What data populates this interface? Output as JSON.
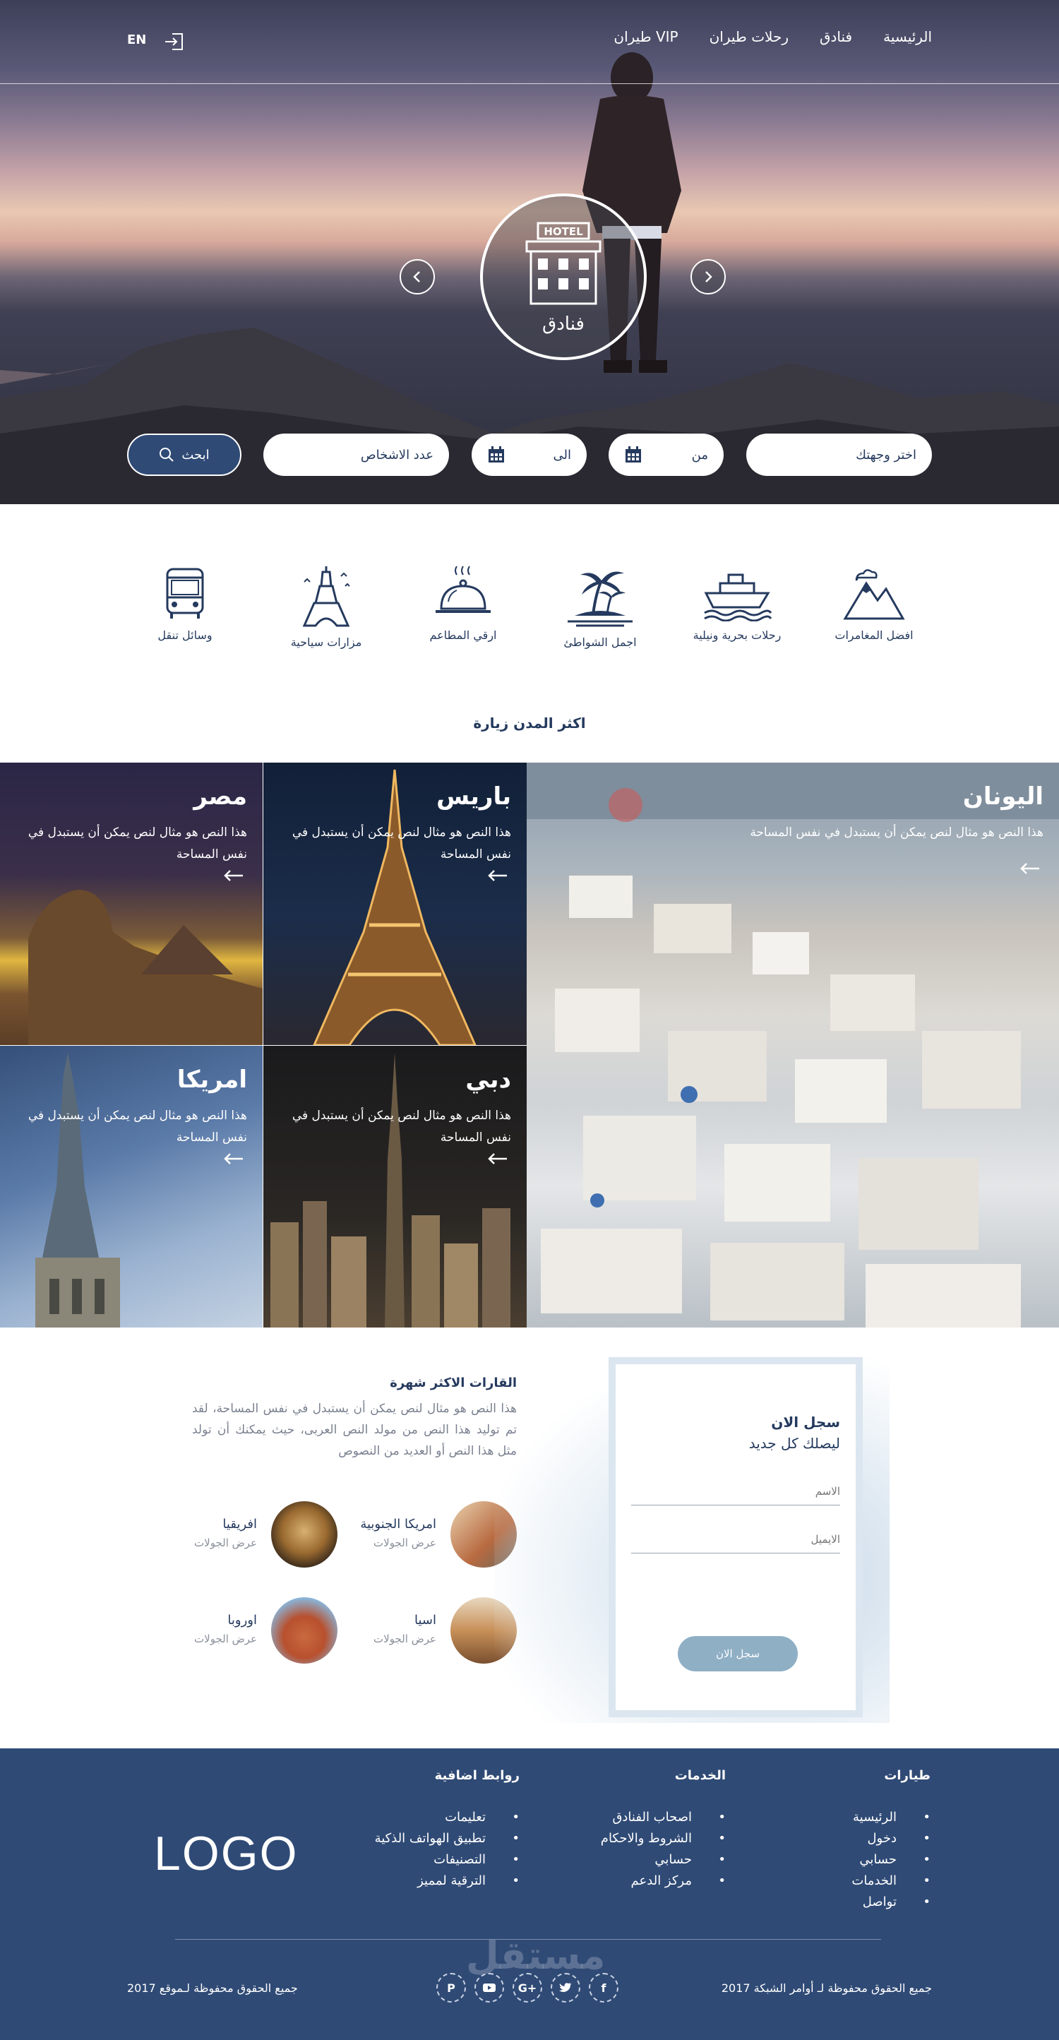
{
  "nav": {
    "items": [
      "الرئيسية",
      "فنادق",
      "رحلات طيران",
      "طيران VIP"
    ],
    "lang": "EN"
  },
  "hero": {
    "circle_sign": "HOTEL",
    "circle_label": "فنادق"
  },
  "search": {
    "destination": "اختر وجهتك",
    "from": "من",
    "to": "الى",
    "persons": "عدد الاشخاص",
    "button": "ابحث"
  },
  "categories": [
    {
      "label": "افضل المغامرات",
      "icon": "mountain-icon"
    },
    {
      "label": "رحلات بحرية ونيلية",
      "icon": "ship-icon"
    },
    {
      "label": "اجمل الشواطئ",
      "icon": "palm-island-icon"
    },
    {
      "label": "ارقي المطاعم",
      "icon": "cloche-icon"
    },
    {
      "label": "مزارات سياحية",
      "icon": "eiffel-icon"
    },
    {
      "label": "وسائل تنقل",
      "icon": "bus-icon"
    }
  ],
  "cities_title": "اكثر المدن زيارة",
  "cities": {
    "greece": {
      "name": "اليونان",
      "desc": "هذا النص هو مثال لنص يمكن أن يستبدل في نفس المساحة"
    },
    "paris": {
      "name": "باريس",
      "desc": "هذا النص هو مثال لنص يمكن أن يستبدل في نفس المساحة"
    },
    "egypt": {
      "name": "مصر",
      "desc": "هذا النص هو مثال لنص يمكن أن يستبدل في نفس المساحة"
    },
    "dubai": {
      "name": "دبي",
      "desc": "هذا النص هو مثال لنص يمكن أن يستبدل في نفس المساحة"
    },
    "america": {
      "name": "امريكا",
      "desc": "هذا النص هو مثال لنص يمكن أن يستبدل في نفس المساحة"
    }
  },
  "continents": {
    "title": "القارات الاكثر شهرة",
    "text": "هذا النص هو مثال لنص يمكن أن يستبدل في نفس المساحة، لقد تم توليد هذا النص من مولد النص العربى، حيث يمكنك أن تولد مثل هذا النص أو العديد من النصوص",
    "items": [
      {
        "name": "امريكا الجنوبية",
        "sub": "عرض الجولات"
      },
      {
        "name": "افريقيا",
        "sub": "عرض الجولات"
      },
      {
        "name": "اسيا",
        "sub": "عرض الجولات"
      },
      {
        "name": "اوروبا",
        "sub": "عرض الجولات"
      }
    ]
  },
  "register": {
    "title": "سجل الان",
    "subtitle": "ليصلك كل جديد",
    "name_placeholder": "الاسم",
    "email_placeholder": "الايميل",
    "button": "سجل الان"
  },
  "footer": {
    "col1": {
      "title": "طيارات",
      "items": [
        "الرئيسية",
        "دخول",
        "حسابي",
        "الخدمات",
        "تواصل"
      ]
    },
    "col2": {
      "title": "الخدمات",
      "items": [
        "اصحاب الفنادق",
        "الشروط والاحكام",
        "حسابي",
        "مركز الدعم"
      ]
    },
    "col3": {
      "title": "روابط اضافية",
      "items": [
        "تعليمات",
        "تطبيق الهواتف الذكية",
        "التصنيفات",
        "الترقية لمميز"
      ]
    },
    "logo": "LOGO",
    "copy_right": "جميع الحقوق محفوظة لـ أوامر الشبكة 2017",
    "copy_left": "جميع الحقوق محفوظة لـموقع 2017",
    "socials": [
      "facebook-icon",
      "twitter-icon",
      "google-plus-icon",
      "youtube-icon",
      "pinterest-icon"
    ],
    "watermark": "مستقل"
  }
}
